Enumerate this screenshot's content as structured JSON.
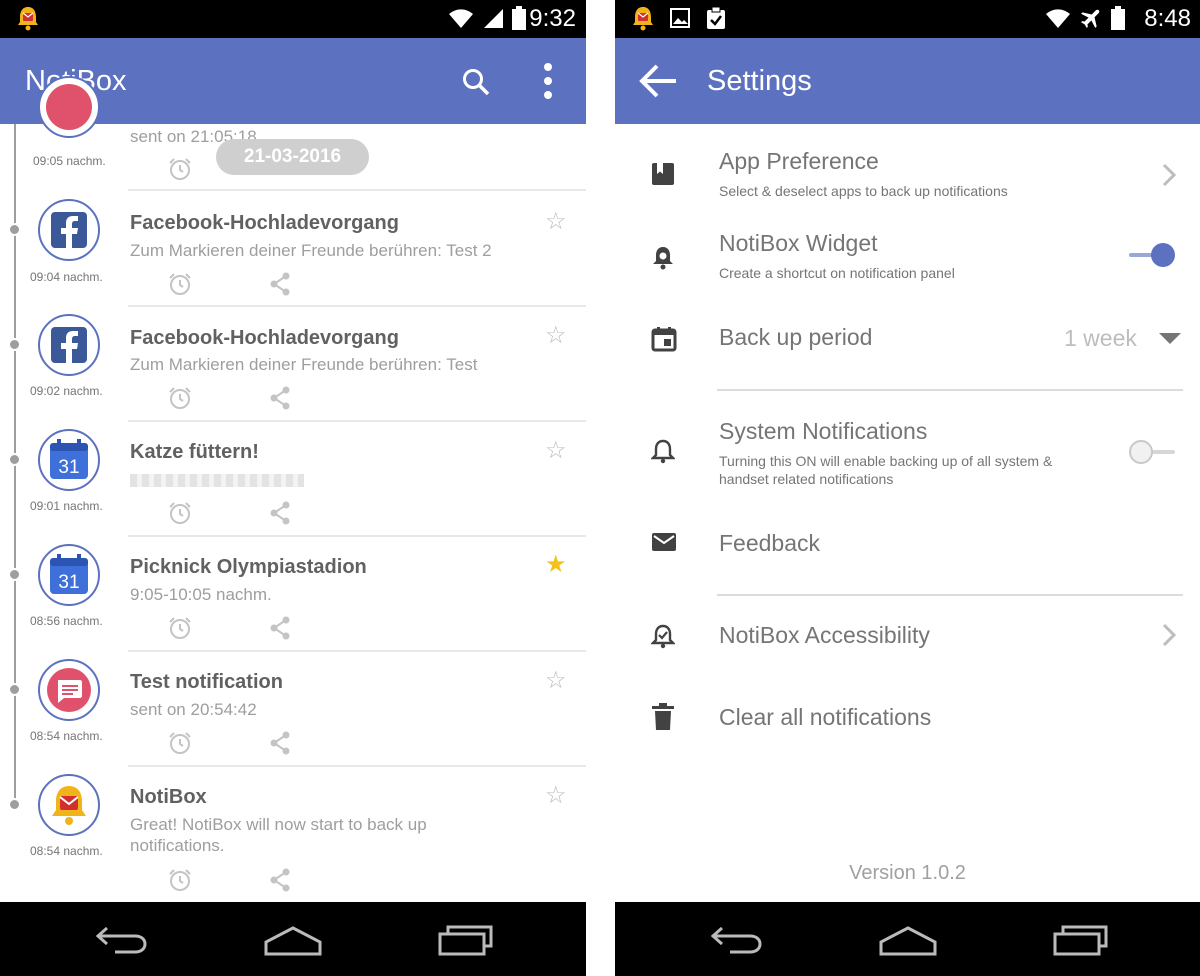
{
  "left_screen": {
    "status_time": "9:32",
    "app_title": "NotiBox",
    "date_chip": "21-03-2016",
    "partial_row": {
      "time": "09:05 nachm.",
      "body": "sent on 21:05:18"
    },
    "notifications": [
      {
        "app": "facebook",
        "time": "09:04 nachm.",
        "title": "Facebook-Hochladevorgang",
        "body": "Zum Markieren deiner Freunde berühren: Test 2",
        "starred": false
      },
      {
        "app": "facebook",
        "time": "09:02 nachm.",
        "title": "Facebook-Hochladevorgang",
        "body": "Zum Markieren deiner Freunde berühren: Test",
        "starred": false
      },
      {
        "app": "calendar",
        "calendar_day": "31",
        "time": "09:01 nachm.",
        "title": "Katze füttern!",
        "body": "",
        "starred": false
      },
      {
        "app": "calendar",
        "calendar_day": "31",
        "time": "08:56 nachm.",
        "title": "Picknick Olympiastadion",
        "body": "9:05-10:05 nachm.",
        "starred": true
      },
      {
        "app": "message",
        "time": "08:54 nachm.",
        "title": "Test notification",
        "body": "sent on 20:54:42",
        "starred": false
      },
      {
        "app": "notibox",
        "time": "08:54 nachm.",
        "title": "NotiBox",
        "body": "Great! NotiBox will now start to back up notifications.",
        "starred": false
      }
    ]
  },
  "right_screen": {
    "status_time": "8:48",
    "app_title": "Settings",
    "items": {
      "app_preference": {
        "title": "App Preference",
        "subtitle": "Select & deselect apps to back up notifications"
      },
      "widget": {
        "title": "NotiBox Widget",
        "subtitle": "Create a shortcut on notification panel",
        "enabled": true
      },
      "backup_period": {
        "title": "Back up period",
        "value": "1 week"
      },
      "system_notifications": {
        "title": "System Notifications",
        "subtitle": "Turning this ON will enable backing up of all system & handset related notifications",
        "enabled": false
      },
      "feedback": {
        "title": "Feedback"
      },
      "accessibility": {
        "title": "NotiBox Accessibility"
      },
      "clear_all": {
        "title": "Clear all notifications"
      }
    },
    "version": "Version 1.0.2"
  },
  "colors": {
    "primary": "#5c71bf",
    "star_on": "#f5c21b",
    "facebook": "#3b5998",
    "calendar": "#3f6fd8",
    "message": "#e0526b"
  }
}
